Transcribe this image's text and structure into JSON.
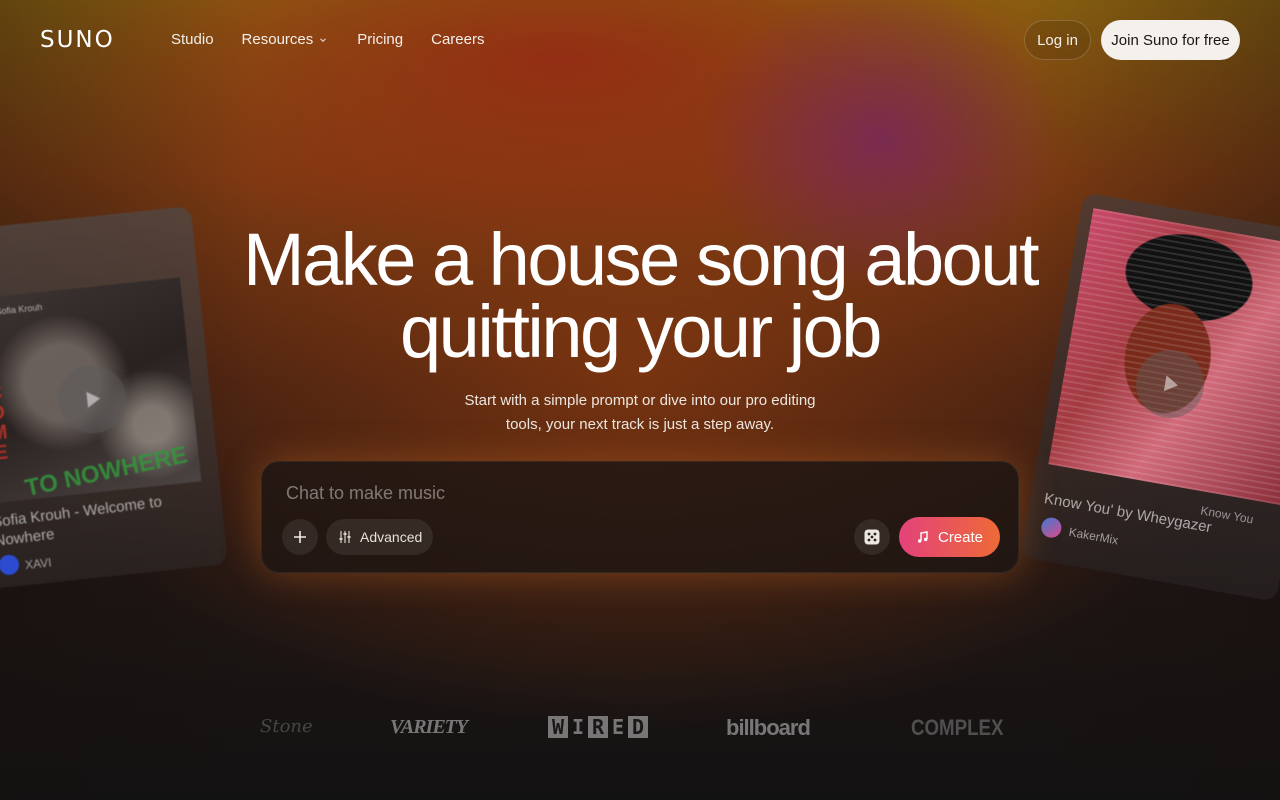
{
  "nav": {
    "logo": "SUNO",
    "links": [
      "Studio",
      "Resources",
      "Pricing",
      "Careers"
    ],
    "login": "Log in",
    "join": "Join Suno for free"
  },
  "hero": {
    "title_line1": "Make a house song about",
    "title_line2": "quitting your job",
    "subtitle_line1": "Start with a simple prompt or dive into our pro editing",
    "subtitle_line2": "tools, your next track is just a step away."
  },
  "prompt": {
    "placeholder": "Chat to make music",
    "advanced_label": "Advanced",
    "create_label": "Create",
    "icons": [
      "plus-icon",
      "sliders-icon",
      "dice-icon",
      "music-note-icon"
    ]
  },
  "cards": {
    "left": {
      "title": "Sofia Krouh - Welcome to Nowhere",
      "author": "XAVI",
      "art_text_vertical": "WELCOME",
      "art_text_bottom": "TO NOWHERE",
      "art_tag": "Sofia Krouh"
    },
    "right": {
      "title": "Know You' by Wheygazer",
      "author": "KakerMix",
      "art_tag": "Know You"
    }
  },
  "press": [
    "Stone",
    "VARIETY",
    "WIRED",
    "billboard",
    "COMPLEX"
  ],
  "colors": {
    "create_gradient_start": "#e3427a",
    "create_gradient_end": "#ee6a38",
    "join_bg": "#f4f1ec"
  }
}
